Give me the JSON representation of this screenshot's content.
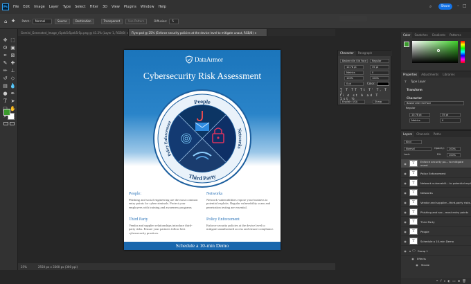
{
  "app": {
    "logo": "Ps"
  },
  "menu": [
    "File",
    "Edit",
    "Image",
    "Layer",
    "Type",
    "Select",
    "Filter",
    "3D",
    "View",
    "Plugins",
    "Window",
    "Help"
  ],
  "share_label": "Share",
  "options_bar": {
    "mode_label": "Patch:",
    "mode_value": "Normal",
    "source_label": "Source",
    "destination_label": "Destination",
    "transparent_label": "Transparent",
    "use_pattern_label": "Use Pattern",
    "diffusion_label": "Diffusion:",
    "diffusion_value": "5"
  },
  "doc_tabs": [
    {
      "label": "Gemini_Generated_Image_r5pek5r5pek5r5p.png @ 41.2% (Layer 1, RGB/8) ×",
      "active": false
    },
    {
      "label": "Flyer.psd @ 25% (Enforce security policies at the device level to mitigate unaut, RGB/8) ×",
      "active": true
    }
  ],
  "status": {
    "zoom": "25%",
    "doc_size": "2550 px x 3300 px (300 ppi)"
  },
  "document": {
    "logo_text": "DataArmor",
    "title": "Cybersecurity Risk Assessment",
    "seal_labels": {
      "top": "People",
      "right": "Networks",
      "bottom": "Third Party",
      "left": "Policy Enforcement"
    },
    "sections": [
      {
        "heading": "People:",
        "body": "Phishing and social engineering are the most common entry points for cybercriminals. Protect your employees with training and awareness programs"
      },
      {
        "heading": "Networks",
        "body": "Network vulnerabilities expose your business to potential exploits. Regular vulnerability scans and penetration testing are essential."
      },
      {
        "heading": "Third Party",
        "body": "Vendor and supplier relationships introduce third-party risks. Ensure your partners follow best cybersecurity practices."
      },
      {
        "heading": "Policy Enforcement",
        "body": "Enforce security policies at the device level to mitigate unauthorized access and ensure compliance."
      }
    ],
    "cta": "Schedule a 10-min Demo"
  },
  "character_panel": {
    "tabs": [
      "Character",
      "Paragraph"
    ],
    "font_family": "Baskerville Old Face",
    "font_style": "Regular",
    "size": "10.78 pt",
    "leading": "35 pt",
    "kerning": "Metrics",
    "tracking": "0",
    "vscale": "100%",
    "hscale": "100%",
    "baseline": "0 pt",
    "color_label": "Color:",
    "language": "English: USA",
    "antialias": "Sharp"
  },
  "color_panel": {
    "tabs": [
      "Color",
      "Swatches",
      "Gradients",
      "Patterns"
    ]
  },
  "properties_panel": {
    "tabs": [
      "Properties",
      "Adjustments",
      "Libraries"
    ],
    "layer_type": "Type Layer",
    "transform_label": "Transform",
    "character_label": "Character",
    "font_family": "Baskerville Old Face",
    "font_style": "Regular",
    "size": "10.78 pt",
    "leading": "35 pt",
    "kerning": "Metrics",
    "tracking": "0"
  },
  "layers_panel": {
    "tabs": [
      "Layers",
      "Channels",
      "Paths"
    ],
    "kind_label": "Kind",
    "blend_mode": "Normal",
    "opacity_label": "Opacity:",
    "opacity_value": "100%",
    "lock_label": "Lock:",
    "fill_label": "Fill:",
    "fill_value": "100%",
    "layers": [
      {
        "name": "Enforce security po... to mitigate unaut",
        "type": "text",
        "selected": true
      },
      {
        "name": "Policy Enforcement",
        "type": "text",
        "selected": false
      },
      {
        "name": "Network vulnerabili... to potential expl",
        "type": "text",
        "selected": false
      },
      {
        "name": "Networks",
        "type": "text",
        "selected": false
      },
      {
        "name": "Vendor and supplier...third-party risks.",
        "type": "text",
        "selected": false
      },
      {
        "name": "Phishing and soc...most entry points",
        "type": "text",
        "selected": false
      },
      {
        "name": "Third Party",
        "type": "text",
        "selected": false
      },
      {
        "name": "People",
        "type": "text",
        "selected": false
      },
      {
        "name": "Schedule a 10-min Demo",
        "type": "text",
        "selected": false
      },
      {
        "name": "Group 1",
        "type": "group",
        "selected": false
      }
    ],
    "effects_label": "Effects",
    "stroke_label": "Stroke"
  }
}
